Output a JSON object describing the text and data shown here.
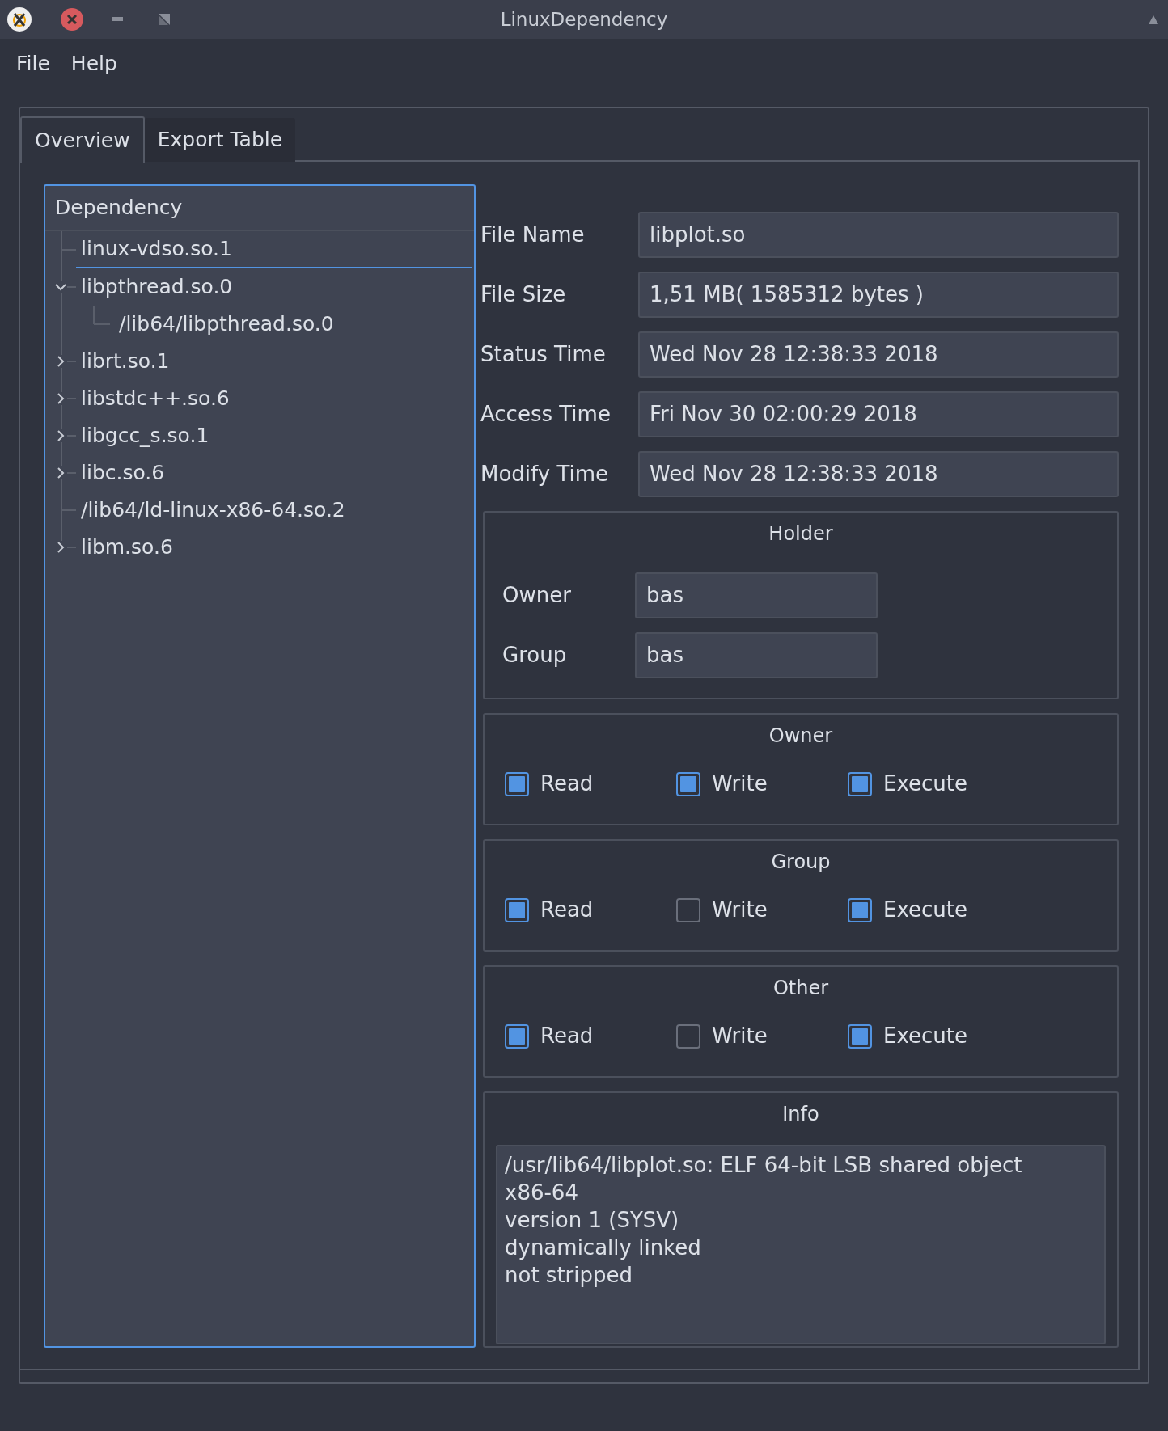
{
  "window": {
    "title": "LinuxDependency"
  },
  "menu": [
    "File",
    "Help"
  ],
  "tabs": [
    {
      "label": "Overview",
      "selected": true
    },
    {
      "label": "Export Table",
      "selected": false
    }
  ],
  "tree": {
    "header": "Dependency",
    "items": [
      {
        "label": "linux-vdso.so.1",
        "selected": true
      },
      {
        "label": "libpthread.so.0",
        "expanded": true,
        "selected": false,
        "children": [
          {
            "label": "/lib64/libpthread.so.0",
            "selected": false
          }
        ]
      },
      {
        "label": "librt.so.1",
        "expanded": false,
        "selected": false
      },
      {
        "label": "libstdc++.so.6",
        "expanded": false,
        "selected": false
      },
      {
        "label": "libgcc_s.so.1",
        "expanded": false,
        "selected": false
      },
      {
        "label": "libc.so.6",
        "expanded": false,
        "selected": false
      },
      {
        "label": "/lib64/ld-linux-x86-64.so.2",
        "selected": false
      },
      {
        "label": "libm.so.6",
        "expanded": false,
        "selected": false
      }
    ]
  },
  "fields": [
    {
      "label": "File Name",
      "value": "libplot.so"
    },
    {
      "label": "File Size",
      "value": "1,51 MB( 1585312 bytes )"
    },
    {
      "label": "Status Time",
      "value": "Wed Nov 28 12:38:33 2018"
    },
    {
      "label": "Access Time",
      "value": "Fri Nov 30 02:00:29 2018"
    },
    {
      "label": "Modify Time",
      "value": "Wed Nov 28 12:38:33 2018"
    }
  ],
  "holder": {
    "title": "Holder",
    "fields": [
      {
        "label": "Owner",
        "value": "bas"
      },
      {
        "label": "Group",
        "value": "bas"
      }
    ]
  },
  "permissions": [
    {
      "title": "Owner",
      "boxes": [
        {
          "label": "Read",
          "checked": true
        },
        {
          "label": "Write",
          "checked": true
        },
        {
          "label": "Execute",
          "checked": true
        }
      ]
    },
    {
      "title": "Group",
      "boxes": [
        {
          "label": "Read",
          "checked": true
        },
        {
          "label": "Write",
          "checked": false
        },
        {
          "label": "Execute",
          "checked": true
        }
      ]
    },
    {
      "title": "Other",
      "boxes": [
        {
          "label": "Read",
          "checked": true
        },
        {
          "label": "Write",
          "checked": false
        },
        {
          "label": "Execute",
          "checked": true
        }
      ]
    }
  ],
  "info": {
    "title": "Info",
    "lines": [
      "/usr/lib64/libplot.so: ELF 64-bit LSB shared object",
      "x86-64",
      "version 1 (SYSV)",
      "dynamically linked",
      "not stripped"
    ]
  }
}
